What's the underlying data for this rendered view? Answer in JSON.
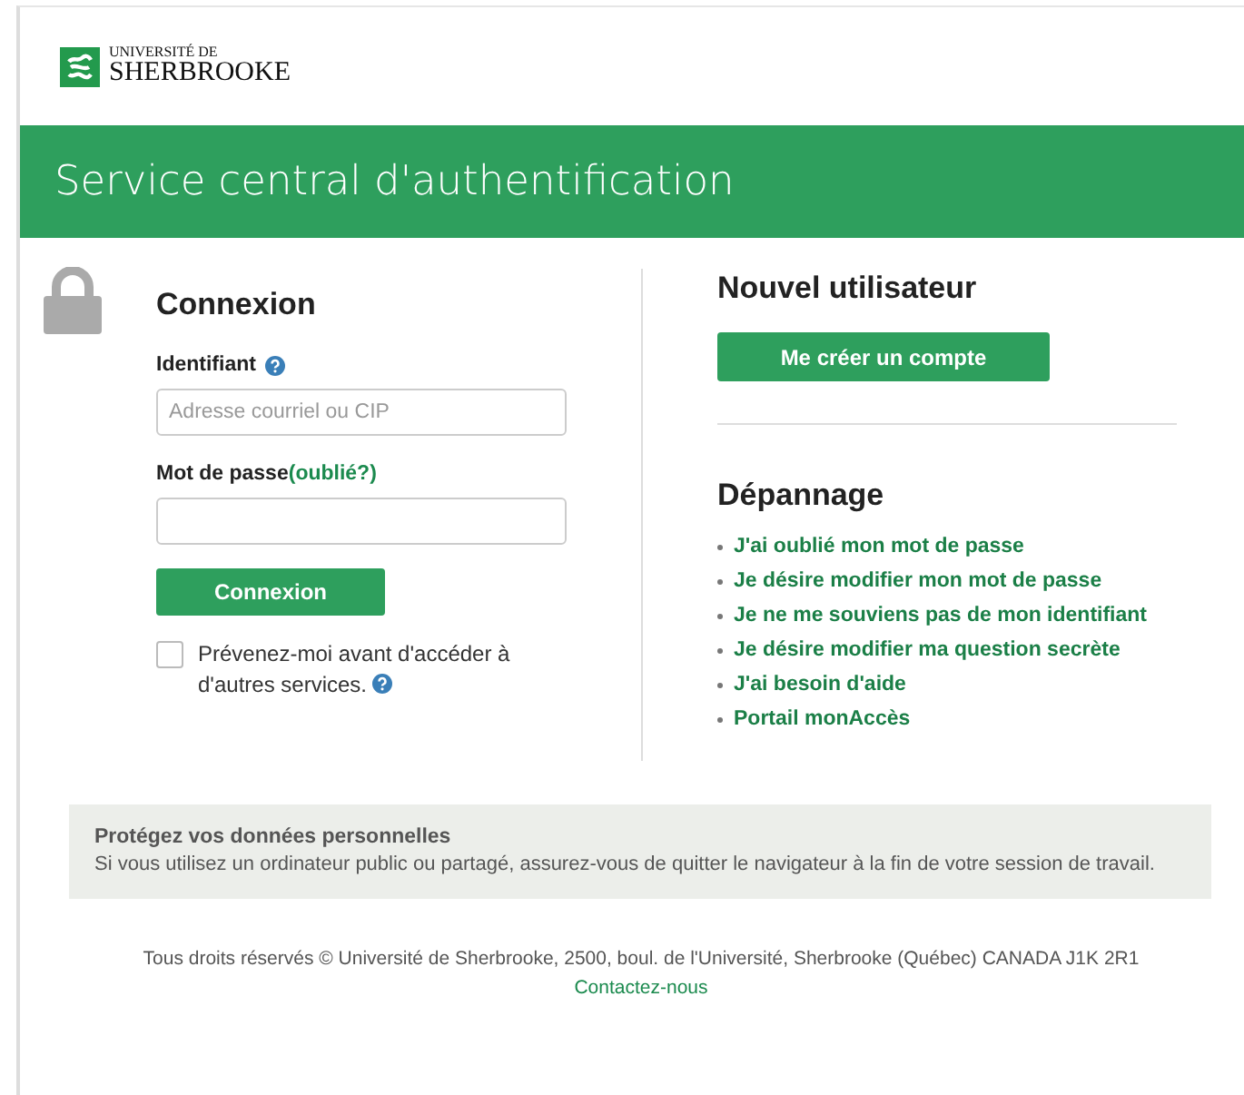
{
  "logo": {
    "line1": "UNIVERSITÉ DE",
    "line2": "SHERBROOKE"
  },
  "banner": {
    "title": "Service central d'authentification"
  },
  "login": {
    "title": "Connexion",
    "username_label": "Identifiant",
    "username": {
      "placeholder": "Adresse courriel ou CIP"
    },
    "password_label": "Mot de passe",
    "forgot_link": "(oublié?)",
    "submit": "Connexion",
    "warn": {
      "checked": false,
      "label": "Prévenez-moi avant d'accéder à d'autres services."
    }
  },
  "new_user": {
    "title": "Nouvel utilisateur",
    "button": "Me créer un compte"
  },
  "troubleshooting": {
    "title": "Dépannage",
    "links": [
      "J'ai oublié mon mot de passe",
      "Je désire modifier mon mot de passe",
      "Je ne me souviens pas de mon identifiant",
      "Je désire modifier ma question secrète",
      "J'ai besoin d'aide",
      "Portail monAccès"
    ]
  },
  "notice": {
    "title": "Protégez vos données personnelles",
    "text": "Si vous utilisez un ordinateur public ou partagé, assurez-vous de quitter le navigateur à la fin de votre session de travail."
  },
  "footer": {
    "copyright": "Tous droits réservés © Université de Sherbrooke, 2500, boul. de l'Université, Sherbrooke (Québec) CANADA J1K 2R1",
    "contact": "Contactez-nous"
  }
}
